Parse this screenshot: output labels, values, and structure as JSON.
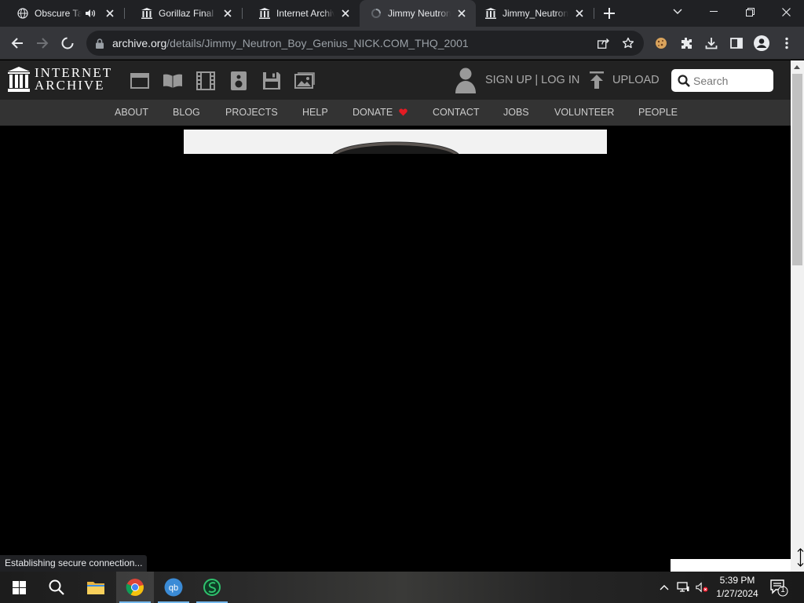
{
  "browser": {
    "tabs": [
      {
        "title": "Obscure Ta",
        "favicon": "globe-icon",
        "audio": true,
        "active": false
      },
      {
        "title": "Gorillaz Final D",
        "favicon": "archive-icon",
        "active": false
      },
      {
        "title": "Internet Archive",
        "favicon": "archive-icon",
        "active": false
      },
      {
        "title": "Jimmy Neutron",
        "favicon": "loading-icon",
        "active": true
      },
      {
        "title": "Jimmy_Neutron",
        "favicon": "archive-icon",
        "active": false
      }
    ],
    "url_host": "archive.org",
    "url_path": "/details/Jimmy_Neutron_Boy_Genius_NICK.COM_THQ_2001",
    "status_text": "Establishing secure connection..."
  },
  "ia": {
    "logo_line1": "INTERNET",
    "logo_line2": "ARCHIVE",
    "media_icons": [
      "web-icon",
      "texts-icon",
      "video-icon",
      "audio-icon",
      "software-icon",
      "images-icon"
    ],
    "signup_login": "SIGN UP | LOG IN",
    "upload": "UPLOAD",
    "search_placeholder": "Search",
    "nav": [
      "ABOUT",
      "BLOG",
      "PROJECTS",
      "HELP",
      "DONATE",
      "CONTACT",
      "JOBS",
      "VOLUNTEER",
      "PEOPLE"
    ]
  },
  "taskbar": {
    "time": "5:39 PM",
    "date": "1/27/2024",
    "notification_count": "1"
  },
  "colors": {
    "donate_heart": "#e31b23",
    "accent_underline": "#76b9ed"
  }
}
